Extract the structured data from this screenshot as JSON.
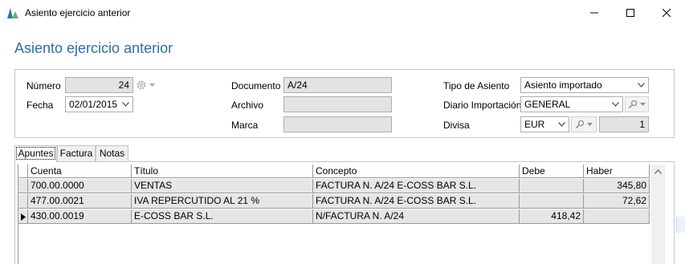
{
  "window": {
    "title": "Asiento ejercicio anterior",
    "controls": {
      "minimize": "minimize-icon",
      "maximize": "maximize-icon",
      "close": "close-icon"
    }
  },
  "heading": "Asiento ejercicio anterior",
  "form": {
    "numero_label": "Número",
    "numero_value": "24",
    "fecha_label": "Fecha",
    "fecha_value": "02/01/2015",
    "documento_label": "Documento",
    "documento_value": "A/24",
    "archivo_label": "Archivo",
    "archivo_value": "",
    "marca_label": "Marca",
    "marca_value": "",
    "tipo_label": "Tipo de Asiento",
    "tipo_value": "Asiento importado",
    "diario_label": "Diario Importación",
    "diario_value": "GENERAL",
    "divisa_label": "Divisa",
    "divisa_value": "EUR",
    "cambio_value": "1"
  },
  "tabs": [
    {
      "label": "Apuntes",
      "active": true
    },
    {
      "label": "Factura",
      "active": false
    },
    {
      "label": "Notas",
      "active": false
    }
  ],
  "grid": {
    "columns": [
      "Cuenta",
      "Título",
      "Concepto",
      "Debe",
      "Haber"
    ],
    "rows": [
      {
        "cuenta": "700.00.0000",
        "titulo": "VENTAS",
        "concepto": "FACTURA N. A/24 E-COSS BAR S.L.",
        "debe": "",
        "haber": "345,80",
        "current": false
      },
      {
        "cuenta": "477.00.0021",
        "titulo": "IVA REPERCUTIDO AL 21 %",
        "concepto": "FACTURA N. A/24 E-COSS BAR S.L.",
        "debe": "",
        "haber": "72,62",
        "current": false
      },
      {
        "cuenta": "430.00.0019",
        "titulo": "E-COSS BAR S.L.",
        "concepto": "N/FACTURA N. A/24",
        "debe": "418,42",
        "haber": "",
        "current": true
      }
    ]
  },
  "colors": {
    "heading": "#2e6da4",
    "row_bg": "#e6e6e6",
    "field_disabled": "#e3e3e3"
  }
}
